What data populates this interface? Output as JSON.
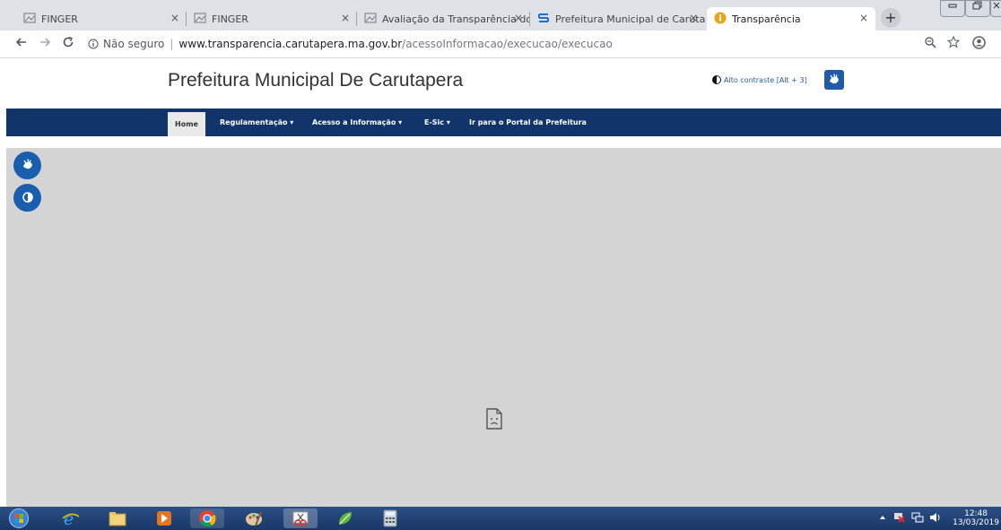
{
  "browser": {
    "tabs": [
      {
        "title": "FINGER",
        "active": false
      },
      {
        "title": "FINGER",
        "active": false
      },
      {
        "title": "Avaliação da Transparência dos",
        "active": false
      },
      {
        "title": "Prefeitura Municipal de Carutap",
        "active": false
      },
      {
        "title": "Transparência",
        "active": true
      }
    ],
    "tab_close": "×",
    "new_tab": "+",
    "address": {
      "security_label": "Não seguro",
      "separator": "|",
      "host": "www.transparencia.carutapera.ma.gov.br",
      "path": "/acessoInformacao/execucao/execucao"
    }
  },
  "site": {
    "title": "Prefeitura Municipal De Carutapera",
    "contrast_label": "Alto contraste [Alt + 3]",
    "nav": {
      "home": "Home",
      "regulamentacao": "Regulamentação ▾",
      "acesso": "Acesso a Informação ▾",
      "esic": "E-Sic ▾",
      "portal": "Ir para o Portal da Prefeitura"
    }
  },
  "taskbar": {
    "time": "12:48",
    "date": "13/03/2019"
  },
  "colors": {
    "navbar": "#11356b",
    "accent": "#1a5eb0",
    "content_bg": "#d4d4d4"
  }
}
